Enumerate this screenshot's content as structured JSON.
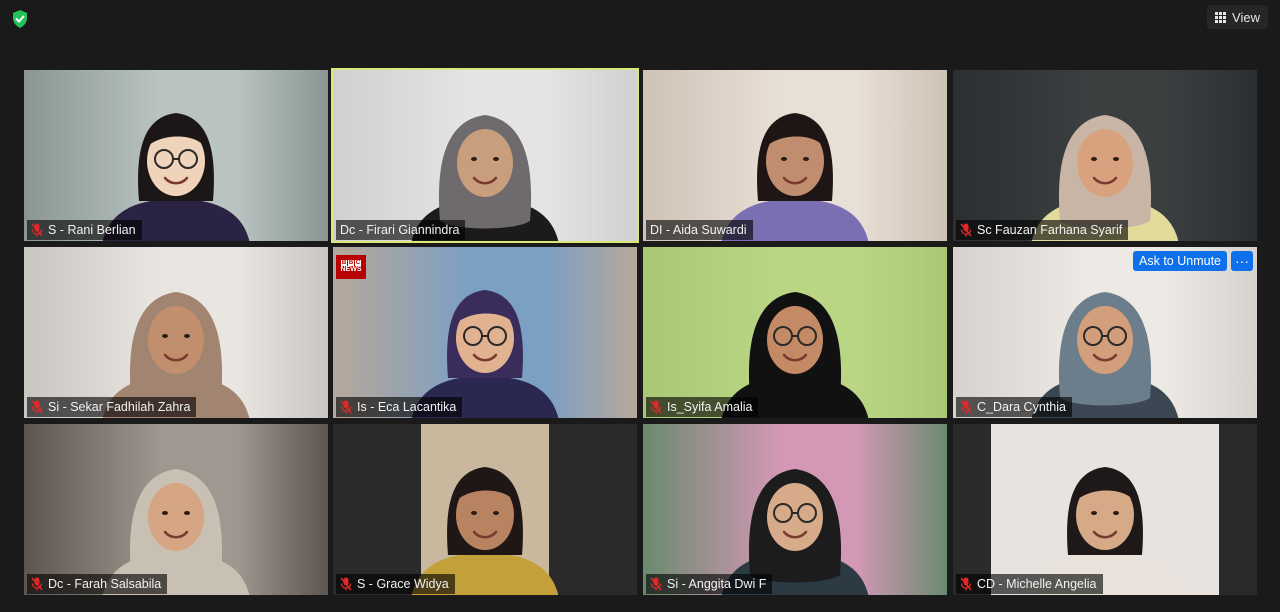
{
  "toolbar": {
    "view_label": "View",
    "security_icon": "shield-check-icon",
    "view_icon": "grid-icon"
  },
  "colors": {
    "active_speaker_border": "#dce875",
    "action_blue": "#0e71eb",
    "security_green": "#23c25a",
    "muted_red": "#e02828"
  },
  "participants": [
    {
      "name": "S - Rani Berlian",
      "muted": true,
      "bg": "#8a9694",
      "wall": "#b9c4c2",
      "skin": "#f0d3bb",
      "hair": "#1c1716",
      "top": "#2b2343",
      "hijab": false,
      "glasses": true
    },
    {
      "name": "Dc - Firari Giannindra",
      "muted": false,
      "active": true,
      "bg": "#d0d0d2",
      "wall": "#e4e4e6",
      "skin": "#c99e7d",
      "hair": "#6e6a6e",
      "top": "#1b1b1c",
      "hijab": true,
      "glasses": false
    },
    {
      "name": "DI - Aida Suwardi",
      "muted": false,
      "bg": "#cfc2b6",
      "wall": "#e8dfd6",
      "skin": "#c08e6e",
      "hair": "#1e1514",
      "top": "#7a6fb3",
      "hijab": false,
      "glasses": false
    },
    {
      "name": "Sc Fauzan Farhana Syarif",
      "muted": true,
      "bg": "#2c2f31",
      "wall": "#3b3f40",
      "skin": "#d9a27f",
      "hair": "#c9b5a6",
      "top": "#e2dc9c",
      "hijab": true,
      "glasses": false
    },
    {
      "name": "Si - Sekar Fadhilah Zahra",
      "muted": true,
      "bg": "#c9c6c1",
      "wall": "#e9e6e1",
      "skin": "#c28f6e",
      "hair": "#a28571",
      "top": "#a28571",
      "hijab": true,
      "glasses": false
    },
    {
      "name": "Is - Eca Lacantika",
      "muted": true,
      "bg": "#b7a89a",
      "wall": "#7c9fc4",
      "skin": "#e0b28f",
      "hair": "#3a2d5c",
      "top": "#2a2850",
      "hijab": false,
      "glasses": true,
      "bbc_badge": {
        "line1": "BBC",
        "line2": "NEWS"
      }
    },
    {
      "name": "Is_Syifa Amalia",
      "muted": true,
      "bg": "#a9c876",
      "wall": "#b9d684",
      "skin": "#c48a65",
      "hair": "#111111",
      "top": "#111111",
      "hijab": true,
      "glasses": true
    },
    {
      "name": "C_Dara Cynthia",
      "muted": true,
      "bg": "#d7d2cd",
      "wall": "#ede9e4",
      "skin": "#d39e7c",
      "hair": "#6c7d8c",
      "top": "#3b4752",
      "hijab": true,
      "glasses": true,
      "ask_to_unmute": "Ask to Unmute",
      "more_label": "···"
    },
    {
      "name": "Dc - Farah Salsabila",
      "muted": true,
      "bg": "#5d5550",
      "wall": "#9e9890",
      "skin": "#d6a583",
      "hair": "#c9c0b4",
      "top": "#c9c0b4",
      "hijab": true,
      "glasses": false
    },
    {
      "name": "S - Grace Widya",
      "muted": true,
      "bg": "#2a2a2a",
      "wall": "#c9b79e",
      "skin": "#b88361",
      "hair": "#1e1715",
      "top": "#c3a03a",
      "hijab": false,
      "glasses": false,
      "narrow": true
    },
    {
      "name": "Si - Anggita Dwi F",
      "muted": true,
      "bg": "#6a8a6e",
      "wall": "#d398b6",
      "skin": "#d7ab8a",
      "hair": "#1c1c1c",
      "top": "#2c3a44",
      "hijab": true,
      "glasses": true
    },
    {
      "name": "CD - Michelle Angelia",
      "muted": true,
      "bg": "#2a2a2a",
      "wall": "#e8e3df",
      "skin": "#d6a987",
      "hair": "#1e1818",
      "top": "#e8e2da",
      "hijab": false,
      "glasses": false,
      "narrow": true
    }
  ]
}
